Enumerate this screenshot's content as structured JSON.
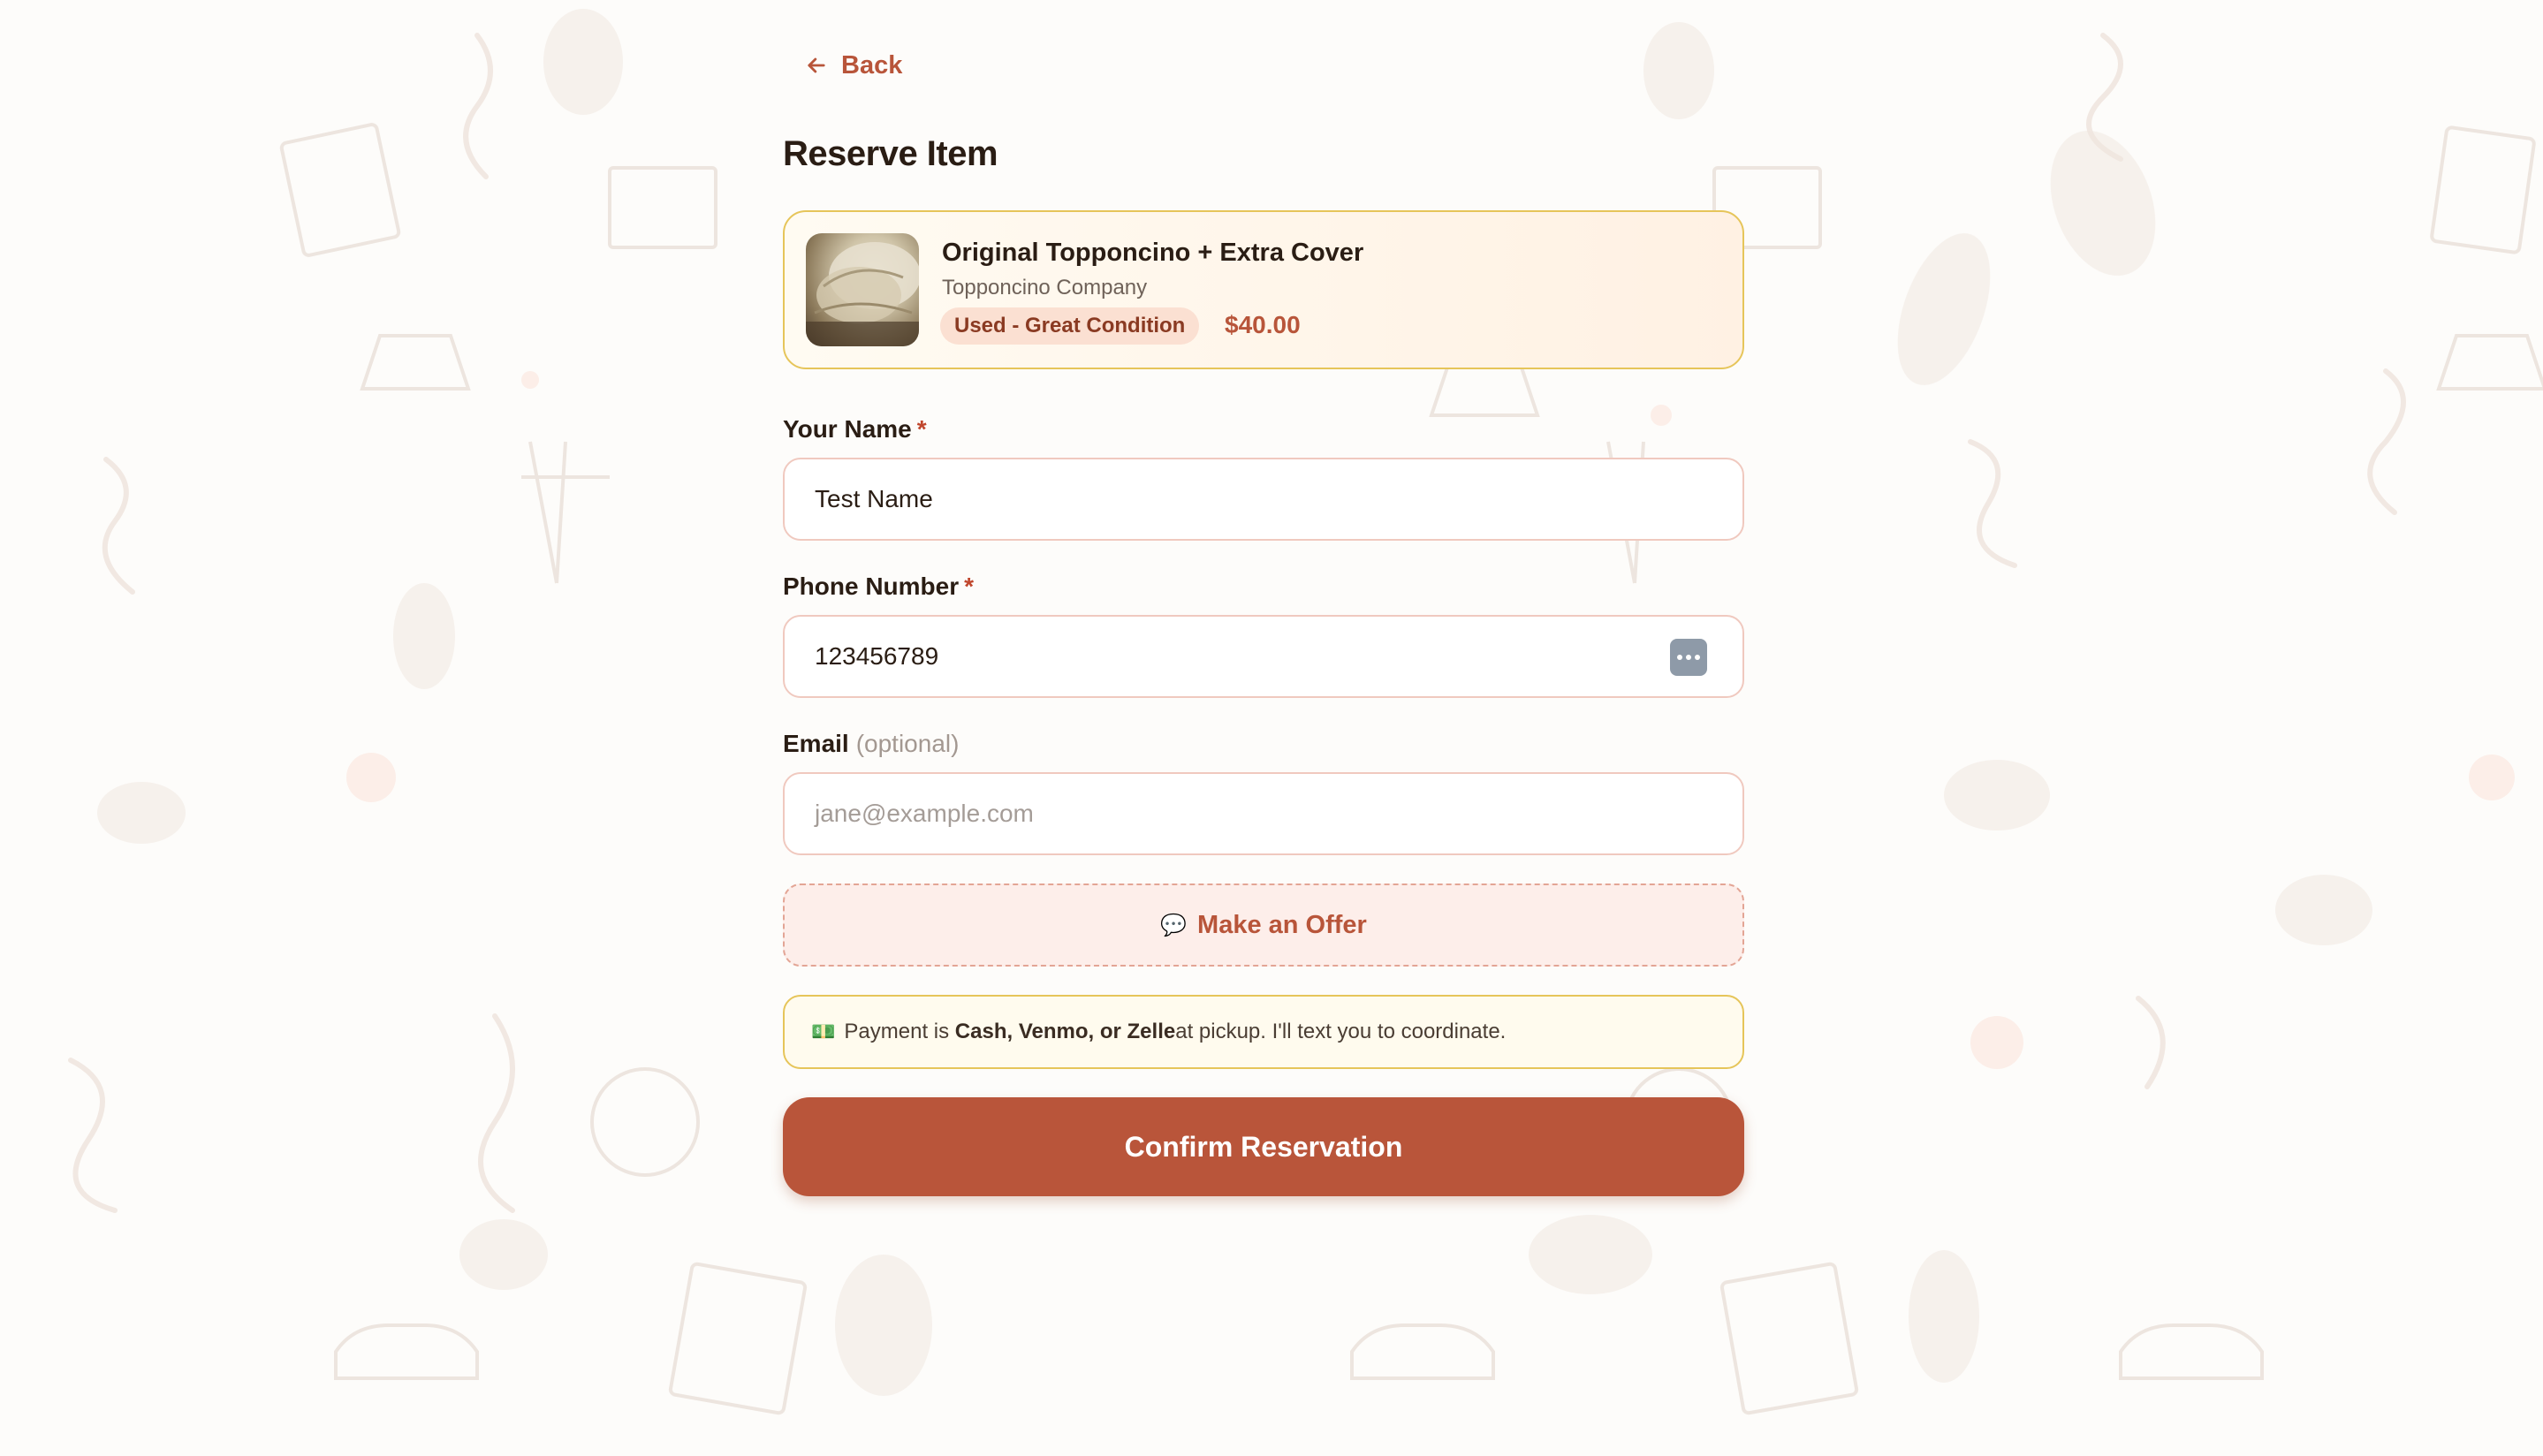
{
  "back": {
    "label": "Back"
  },
  "page": {
    "title": "Reserve Item"
  },
  "item": {
    "name": "Original Topponcino + Extra Cover",
    "brand": "Topponcino Company",
    "condition": "Used - Great Condition",
    "price": "$40.00"
  },
  "form": {
    "name": {
      "label": "Your Name",
      "required_mark": "*",
      "value": "Test Name"
    },
    "phone": {
      "label": "Phone Number",
      "required_mark": "*",
      "value": "123456789"
    },
    "email": {
      "label": "Email",
      "optional_text": "(optional)",
      "placeholder": "jane@example.com"
    }
  },
  "offer": {
    "label": "Make an Offer",
    "icon": "speech-bubble-icon"
  },
  "payment_note": {
    "icon": "cash-icon",
    "prefix": "Payment is ",
    "methods": "Cash, Venmo, or Zelle",
    "suffix": "at pickup. I'll text you to coordinate."
  },
  "confirm": {
    "label": "Confirm Reservation"
  },
  "colors": {
    "accent": "#b9553a",
    "card_border": "#e6c55a",
    "field_border": "#f0c9bf",
    "badge_bg": "#fbe0d2"
  }
}
